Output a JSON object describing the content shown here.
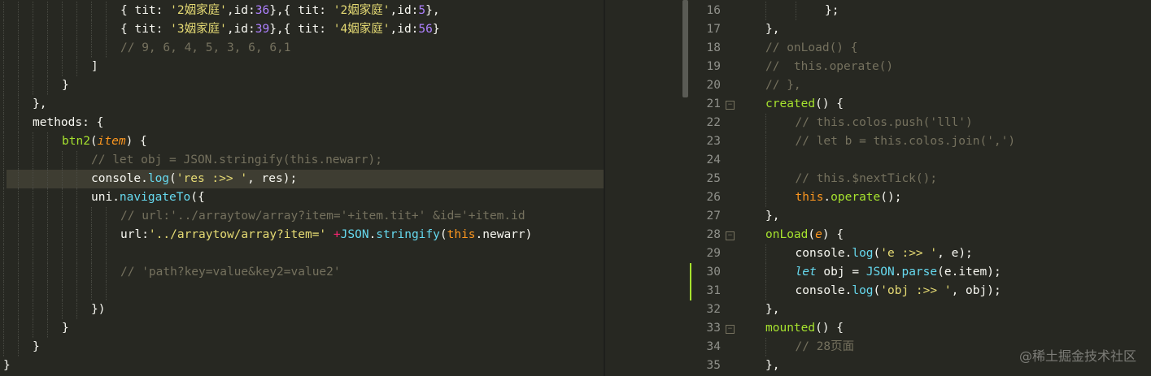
{
  "left_editor": {
    "lines": [
      {
        "indent": 9,
        "tokens": [
          [
            "p",
            "{ tit: "
          ],
          [
            "str",
            "'2姻家庭'"
          ],
          [
            "p",
            ",id:"
          ],
          [
            "num",
            "36"
          ],
          [
            "p",
            "},{ tit: "
          ],
          [
            "str",
            "'2姻家庭'"
          ],
          [
            "p",
            ",id:"
          ],
          [
            "num",
            "5"
          ],
          [
            "p",
            "},"
          ]
        ]
      },
      {
        "indent": 9,
        "tokens": [
          [
            "p",
            "{ tit: "
          ],
          [
            "str",
            "'3姻家庭'"
          ],
          [
            "p",
            ",id:"
          ],
          [
            "num",
            "39"
          ],
          [
            "p",
            "},{ tit: "
          ],
          [
            "str",
            "'4姻家庭'"
          ],
          [
            "p",
            ",id:"
          ],
          [
            "num",
            "56"
          ],
          [
            "p",
            "}"
          ]
        ]
      },
      {
        "indent": 9,
        "tokens": [
          [
            "com",
            "// 9, 6, 4, 5, 3, 6, 6,1"
          ]
        ]
      },
      {
        "indent": 7,
        "tokens": [
          [
            "p",
            "]"
          ]
        ]
      },
      {
        "indent": 5,
        "tokens": [
          [
            "p",
            "}"
          ]
        ]
      },
      {
        "indent": 3,
        "tokens": [
          [
            "p",
            "},"
          ]
        ]
      },
      {
        "indent": 3,
        "tokens": [
          [
            "p",
            "methods: {"
          ]
        ]
      },
      {
        "indent": 5,
        "tokens": [
          [
            "fn",
            "btn2"
          ],
          [
            "p",
            "("
          ],
          [
            "param",
            "item"
          ],
          [
            "p",
            ") {"
          ]
        ]
      },
      {
        "indent": 7,
        "tokens": [
          [
            "com",
            "// let obj = JSON.stringify(this.newarr);"
          ]
        ]
      },
      {
        "indent": 7,
        "highlight": true,
        "tokens": [
          [
            "p",
            "console."
          ],
          [
            "sup",
            "log"
          ],
          [
            "p",
            "("
          ],
          [
            "str",
            "'res :>> '"
          ],
          [
            "p",
            ", res);"
          ]
        ]
      },
      {
        "indent": 7,
        "tokens": [
          [
            "p",
            "uni."
          ],
          [
            "sup",
            "navigateTo"
          ],
          [
            "p",
            "({"
          ]
        ]
      },
      {
        "indent": 9,
        "tokens": [
          [
            "com",
            "// url:'../arraytow/array?item='+item.tit+' &id='+item.id"
          ]
        ]
      },
      {
        "indent": 9,
        "tokens": [
          [
            "p",
            "url:"
          ],
          [
            "str",
            "'../arraytow/array?item='"
          ],
          [
            "p",
            " "
          ],
          [
            "kw",
            "+"
          ],
          [
            "sup",
            "JSON"
          ],
          [
            "p",
            "."
          ],
          [
            "sup",
            "stringify"
          ],
          [
            "p",
            "("
          ],
          [
            "this",
            "this"
          ],
          [
            "p",
            ".newarr)"
          ]
        ]
      },
      {
        "indent": 9,
        "tokens": [
          [
            "p",
            ""
          ]
        ]
      },
      {
        "indent": 9,
        "tokens": [
          [
            "com",
            "// 'path?key=value&key2=value2'"
          ]
        ]
      },
      {
        "indent": 9,
        "tokens": [
          [
            "p",
            ""
          ]
        ]
      },
      {
        "indent": 7,
        "tokens": [
          [
            "p",
            "})"
          ]
        ]
      },
      {
        "indent": 5,
        "tokens": [
          [
            "p",
            "}"
          ]
        ]
      },
      {
        "indent": 3,
        "tokens": [
          [
            "p",
            "}"
          ]
        ]
      },
      {
        "indent": 1,
        "tokens": [
          [
            "p",
            "}"
          ]
        ]
      }
    ]
  },
  "right_editor": {
    "lines": [
      {
        "num": "16",
        "indent": 3,
        "tokens": [
          [
            "p",
            "};"
          ]
        ]
      },
      {
        "num": "17",
        "indent": 1,
        "tokens": [
          [
            "p",
            "},"
          ]
        ]
      },
      {
        "num": "18",
        "indent": 1,
        "tokens": [
          [
            "com",
            "// onLoad() {"
          ]
        ]
      },
      {
        "num": "19",
        "indent": 1,
        "tokens": [
          [
            "com",
            "//  this.operate()"
          ]
        ]
      },
      {
        "num": "20",
        "indent": 1,
        "tokens": [
          [
            "com",
            "// },"
          ]
        ]
      },
      {
        "num": "21",
        "indent": 1,
        "fold": true,
        "tokens": [
          [
            "fn",
            "created"
          ],
          [
            "p",
            "() {"
          ]
        ]
      },
      {
        "num": "22",
        "indent": 2,
        "tokens": [
          [
            "com",
            "// this.colos.push('lll')"
          ]
        ]
      },
      {
        "num": "23",
        "indent": 2,
        "tokens": [
          [
            "com",
            "// let b = this.colos.join(',')"
          ]
        ]
      },
      {
        "num": "24",
        "indent": 2,
        "tokens": [
          [
            "p",
            ""
          ]
        ]
      },
      {
        "num": "25",
        "indent": 2,
        "tokens": [
          [
            "com",
            "// this.$nextTick();"
          ]
        ]
      },
      {
        "num": "26",
        "indent": 2,
        "tokens": [
          [
            "this",
            "this"
          ],
          [
            "p",
            "."
          ],
          [
            "fn",
            "operate"
          ],
          [
            "p",
            "();"
          ]
        ]
      },
      {
        "num": "27",
        "indent": 1,
        "tokens": [
          [
            "p",
            "},"
          ]
        ]
      },
      {
        "num": "28",
        "indent": 1,
        "fold": true,
        "tokens": [
          [
            "fn",
            "onLoad"
          ],
          [
            "p",
            "("
          ],
          [
            "param",
            "e"
          ],
          [
            "p",
            ") {"
          ]
        ]
      },
      {
        "num": "29",
        "indent": 2,
        "tokens": [
          [
            "p",
            "console."
          ],
          [
            "sup",
            "log"
          ],
          [
            "p",
            "("
          ],
          [
            "str",
            "'e :>> '"
          ],
          [
            "p",
            ", e);"
          ]
        ]
      },
      {
        "num": "30",
        "indent": 2,
        "git": true,
        "tokens": [
          [
            "italkw",
            "let"
          ],
          [
            "p",
            " obj = "
          ],
          [
            "sup",
            "JSON"
          ],
          [
            "p",
            "."
          ],
          [
            "sup",
            "parse"
          ],
          [
            "p",
            "(e.item);"
          ]
        ]
      },
      {
        "num": "31",
        "indent": 2,
        "git": true,
        "tokens": [
          [
            "p",
            "console."
          ],
          [
            "sup",
            "log"
          ],
          [
            "p",
            "("
          ],
          [
            "str",
            "'obj :>> '"
          ],
          [
            "p",
            ", obj);"
          ]
        ]
      },
      {
        "num": "32",
        "indent": 1,
        "tokens": [
          [
            "p",
            "},"
          ]
        ]
      },
      {
        "num": "33",
        "indent": 1,
        "fold": true,
        "tokens": [
          [
            "fn",
            "mounted"
          ],
          [
            "p",
            "() {"
          ]
        ]
      },
      {
        "num": "34",
        "indent": 2,
        "tokens": [
          [
            "com",
            "// 28页面"
          ]
        ]
      },
      {
        "num": "35",
        "indent": 1,
        "tokens": [
          [
            "p",
            "},"
          ]
        ]
      }
    ]
  },
  "watermark": "@稀土掘金技术社区",
  "colors": {
    "background": "#272822",
    "comment": "#75715e",
    "string": "#e6db74",
    "number": "#ae81ff",
    "function": "#a6e22e",
    "keyword": "#f92672",
    "support": "#66d9ef",
    "parameter": "#fd971f"
  }
}
